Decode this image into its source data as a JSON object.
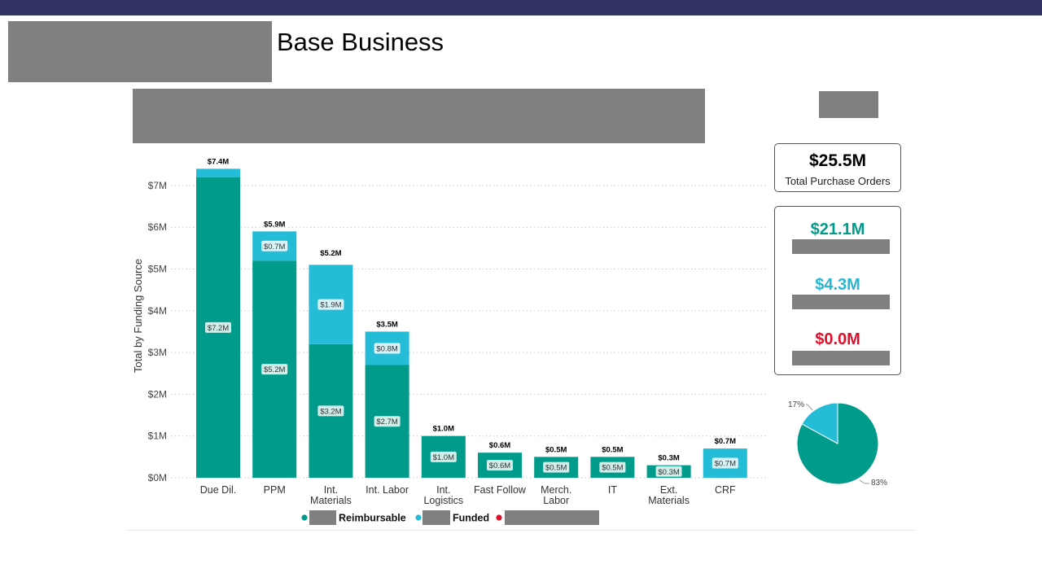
{
  "page": {
    "title": "Base Business"
  },
  "kpis": {
    "total_value": "$25.5M",
    "total_label": "Total Purchase Orders",
    "items": [
      {
        "value": "$21.1M",
        "color": "#009b8a"
      },
      {
        "value": "$4.3M",
        "color": "#27b6d3"
      },
      {
        "value": "$0.0M",
        "color": "#e0102c"
      }
    ]
  },
  "colors": {
    "reimbursable": "#009b8a",
    "funded": "#25bcd8",
    "third": "#e0102c",
    "header_bar": "#323264"
  },
  "legend": [
    {
      "label": "Reimbursable",
      "color": "#009b8a"
    },
    {
      "label": "Funded",
      "color": "#25bcd8"
    },
    {
      "label": "",
      "color": "#e0102c"
    }
  ],
  "chart_data": [
    {
      "type": "bar",
      "stacked": true,
      "ylabel": "Total by Funding Source",
      "ylim": [
        0,
        7.4
      ],
      "yticks": [
        0,
        1,
        2,
        3,
        4,
        5,
        6,
        7
      ],
      "ytick_labels": [
        "$0M",
        "$1M",
        "$2M",
        "$3M",
        "$4M",
        "$5M",
        "$6M",
        "$7M"
      ],
      "grid": true,
      "legend_position": "bottom",
      "categories": [
        [
          "Due Dil."
        ],
        [
          "PPM"
        ],
        [
          "Int.",
          "Materials"
        ],
        [
          "Int. Labor"
        ],
        [
          "Int.",
          "Logistics"
        ],
        [
          "Fast Follow"
        ],
        [
          "Merch.",
          "Labor"
        ],
        [
          "IT"
        ],
        [
          "Ext.",
          "Materials"
        ],
        [
          "CRF"
        ]
      ],
      "series": [
        {
          "name": "Reimbursable",
          "values": [
            7.2,
            5.2,
            3.2,
            2.7,
            1.0,
            0.6,
            0.5,
            0.5,
            0.3,
            0
          ],
          "labels": [
            "$7.2M",
            "$5.2M",
            "$3.2M",
            "$2.7M",
            "$1.0M",
            "$0.6M",
            "$0.5M",
            "$0.5M",
            "$0.3M",
            ""
          ]
        },
        {
          "name": "Funded",
          "values": [
            0.2,
            0.7,
            1.9,
            0.8,
            0,
            0,
            0,
            0,
            0,
            0.7
          ],
          "labels": [
            "",
            "$0.7M",
            "$1.9M",
            "$0.8M",
            "",
            "",
            "",
            "",
            "",
            "$0.7M"
          ]
        }
      ],
      "totals": [
        7.4,
        5.9,
        5.2,
        3.5,
        1.0,
        0.6,
        0.5,
        0.5,
        0.3,
        0.7
      ],
      "total_labels": [
        "$7.4M",
        "$5.9M",
        "$5.2M",
        "$3.5M",
        "$1.0M",
        "$0.6M",
        "$0.5M",
        "$0.5M",
        "$0.3M",
        "$0.7M"
      ]
    },
    {
      "type": "pie",
      "slices": [
        {
          "value": 83,
          "label": "83%",
          "color": "#009b8a"
        },
        {
          "value": 17,
          "label": "17%",
          "color": "#25bcd8"
        }
      ]
    }
  ]
}
